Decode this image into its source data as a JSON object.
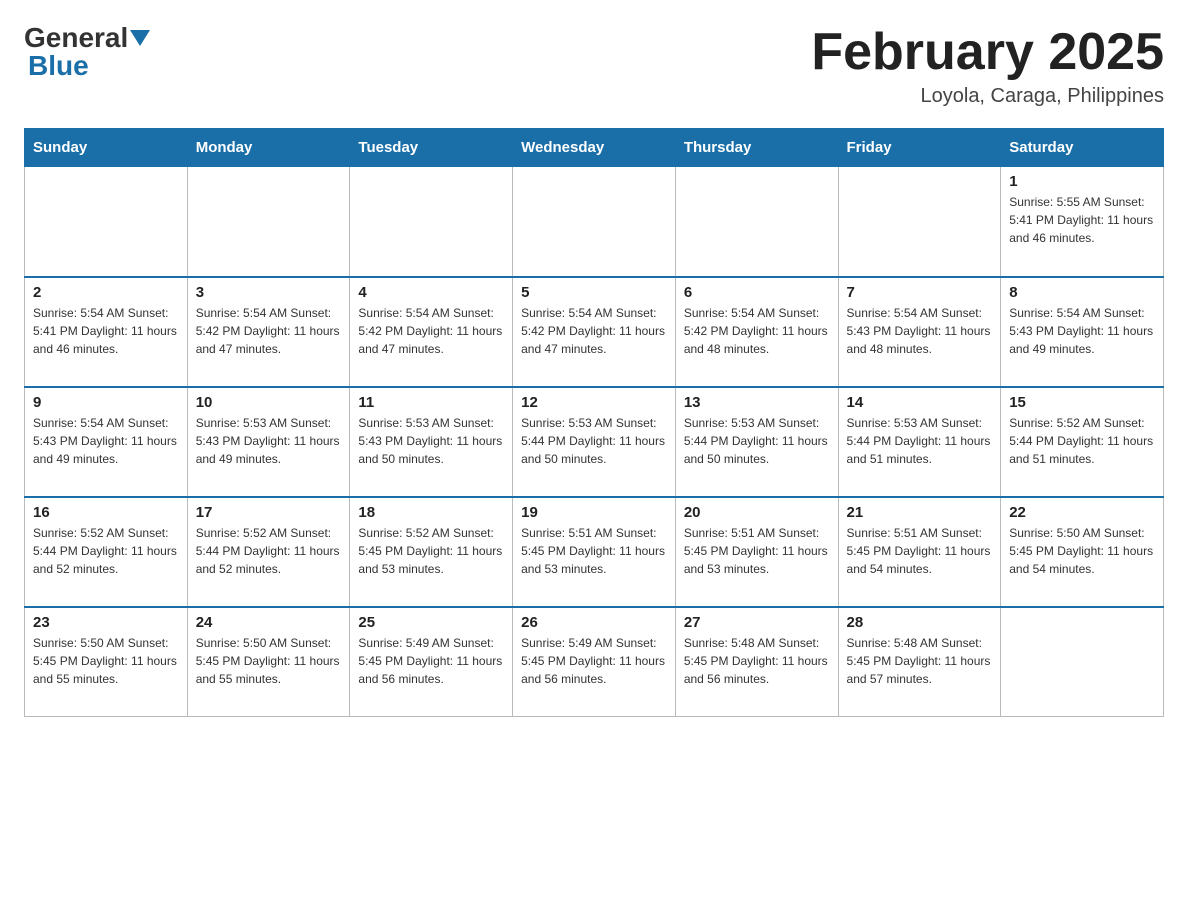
{
  "logo": {
    "general": "General",
    "blue": "Blue"
  },
  "title": "February 2025",
  "subtitle": "Loyola, Caraga, Philippines",
  "days_of_week": [
    "Sunday",
    "Monday",
    "Tuesday",
    "Wednesday",
    "Thursday",
    "Friday",
    "Saturday"
  ],
  "weeks": [
    [
      {
        "day": "",
        "info": ""
      },
      {
        "day": "",
        "info": ""
      },
      {
        "day": "",
        "info": ""
      },
      {
        "day": "",
        "info": ""
      },
      {
        "day": "",
        "info": ""
      },
      {
        "day": "",
        "info": ""
      },
      {
        "day": "1",
        "info": "Sunrise: 5:55 AM\nSunset: 5:41 PM\nDaylight: 11 hours\nand 46 minutes."
      }
    ],
    [
      {
        "day": "2",
        "info": "Sunrise: 5:54 AM\nSunset: 5:41 PM\nDaylight: 11 hours\nand 46 minutes."
      },
      {
        "day": "3",
        "info": "Sunrise: 5:54 AM\nSunset: 5:42 PM\nDaylight: 11 hours\nand 47 minutes."
      },
      {
        "day": "4",
        "info": "Sunrise: 5:54 AM\nSunset: 5:42 PM\nDaylight: 11 hours\nand 47 minutes."
      },
      {
        "day": "5",
        "info": "Sunrise: 5:54 AM\nSunset: 5:42 PM\nDaylight: 11 hours\nand 47 minutes."
      },
      {
        "day": "6",
        "info": "Sunrise: 5:54 AM\nSunset: 5:42 PM\nDaylight: 11 hours\nand 48 minutes."
      },
      {
        "day": "7",
        "info": "Sunrise: 5:54 AM\nSunset: 5:43 PM\nDaylight: 11 hours\nand 48 minutes."
      },
      {
        "day": "8",
        "info": "Sunrise: 5:54 AM\nSunset: 5:43 PM\nDaylight: 11 hours\nand 49 minutes."
      }
    ],
    [
      {
        "day": "9",
        "info": "Sunrise: 5:54 AM\nSunset: 5:43 PM\nDaylight: 11 hours\nand 49 minutes."
      },
      {
        "day": "10",
        "info": "Sunrise: 5:53 AM\nSunset: 5:43 PM\nDaylight: 11 hours\nand 49 minutes."
      },
      {
        "day": "11",
        "info": "Sunrise: 5:53 AM\nSunset: 5:43 PM\nDaylight: 11 hours\nand 50 minutes."
      },
      {
        "day": "12",
        "info": "Sunrise: 5:53 AM\nSunset: 5:44 PM\nDaylight: 11 hours\nand 50 minutes."
      },
      {
        "day": "13",
        "info": "Sunrise: 5:53 AM\nSunset: 5:44 PM\nDaylight: 11 hours\nand 50 minutes."
      },
      {
        "day": "14",
        "info": "Sunrise: 5:53 AM\nSunset: 5:44 PM\nDaylight: 11 hours\nand 51 minutes."
      },
      {
        "day": "15",
        "info": "Sunrise: 5:52 AM\nSunset: 5:44 PM\nDaylight: 11 hours\nand 51 minutes."
      }
    ],
    [
      {
        "day": "16",
        "info": "Sunrise: 5:52 AM\nSunset: 5:44 PM\nDaylight: 11 hours\nand 52 minutes."
      },
      {
        "day": "17",
        "info": "Sunrise: 5:52 AM\nSunset: 5:44 PM\nDaylight: 11 hours\nand 52 minutes."
      },
      {
        "day": "18",
        "info": "Sunrise: 5:52 AM\nSunset: 5:45 PM\nDaylight: 11 hours\nand 53 minutes."
      },
      {
        "day": "19",
        "info": "Sunrise: 5:51 AM\nSunset: 5:45 PM\nDaylight: 11 hours\nand 53 minutes."
      },
      {
        "day": "20",
        "info": "Sunrise: 5:51 AM\nSunset: 5:45 PM\nDaylight: 11 hours\nand 53 minutes."
      },
      {
        "day": "21",
        "info": "Sunrise: 5:51 AM\nSunset: 5:45 PM\nDaylight: 11 hours\nand 54 minutes."
      },
      {
        "day": "22",
        "info": "Sunrise: 5:50 AM\nSunset: 5:45 PM\nDaylight: 11 hours\nand 54 minutes."
      }
    ],
    [
      {
        "day": "23",
        "info": "Sunrise: 5:50 AM\nSunset: 5:45 PM\nDaylight: 11 hours\nand 55 minutes."
      },
      {
        "day": "24",
        "info": "Sunrise: 5:50 AM\nSunset: 5:45 PM\nDaylight: 11 hours\nand 55 minutes."
      },
      {
        "day": "25",
        "info": "Sunrise: 5:49 AM\nSunset: 5:45 PM\nDaylight: 11 hours\nand 56 minutes."
      },
      {
        "day": "26",
        "info": "Sunrise: 5:49 AM\nSunset: 5:45 PM\nDaylight: 11 hours\nand 56 minutes."
      },
      {
        "day": "27",
        "info": "Sunrise: 5:48 AM\nSunset: 5:45 PM\nDaylight: 11 hours\nand 56 minutes."
      },
      {
        "day": "28",
        "info": "Sunrise: 5:48 AM\nSunset: 5:45 PM\nDaylight: 11 hours\nand 57 minutes."
      },
      {
        "day": "",
        "info": ""
      }
    ]
  ]
}
